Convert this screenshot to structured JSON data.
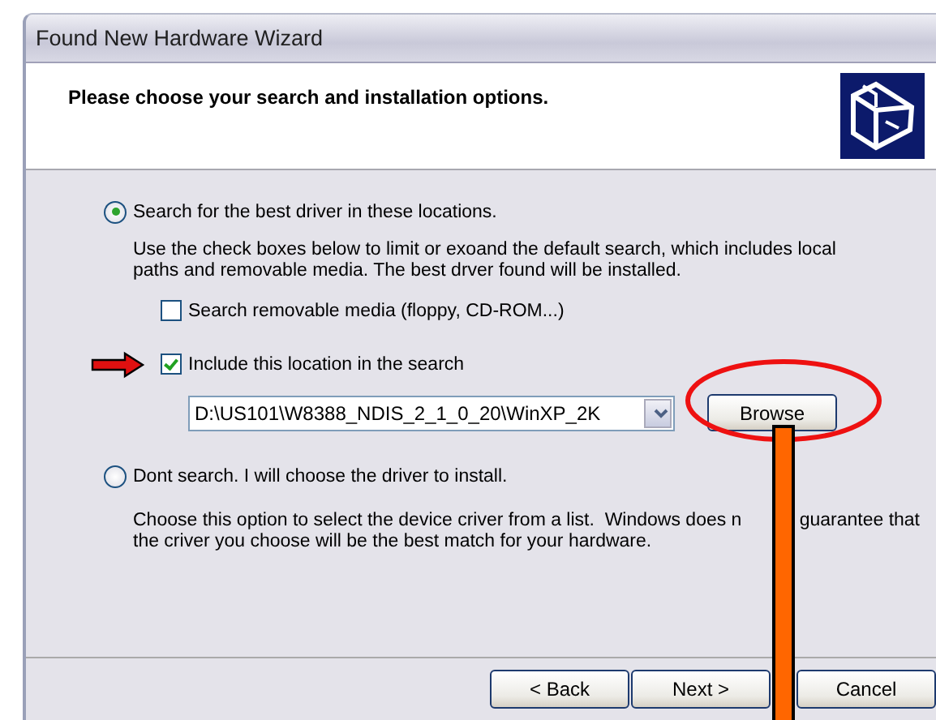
{
  "window": {
    "title": "Found New Hardware Wizard"
  },
  "header": {
    "title": "Please choose your search and installation options."
  },
  "options": [
    {
      "label": "Search for the best driver in these locations.",
      "selected": true,
      "description_lines": [
        {
          "segments": [
            "Use the check boxes below to limit or exoand the default search, which includes local"
          ]
        },
        {
          "segments": [
            "paths and removable media. The best drver found will be installed."
          ]
        }
      ],
      "checkboxes": [
        {
          "label": "Search removable media (floppy, CD-ROM...)",
          "checked": false
        },
        {
          "label": "Include this location in the search",
          "checked": true
        }
      ],
      "location": {
        "value": "D:\\US101\\W8388_NDIS_2_1_0_20\\WinXP_2K",
        "browse_button": "Browse"
      }
    },
    {
      "label": "Dont search. I will choose the driver to install.",
      "selected": false,
      "description_lines": [
        {
          "segments": [
            "Choose this option to select the device criver from a list.  Windows does n",
            "guarantee that"
          ]
        },
        {
          "segments": [
            "the criver you choose will be the best match for your hardware."
          ]
        }
      ]
    }
  ],
  "buttons": [
    {
      "label": "< Back"
    },
    {
      "label": "Next >"
    },
    {
      "label": "Cancel"
    }
  ]
}
